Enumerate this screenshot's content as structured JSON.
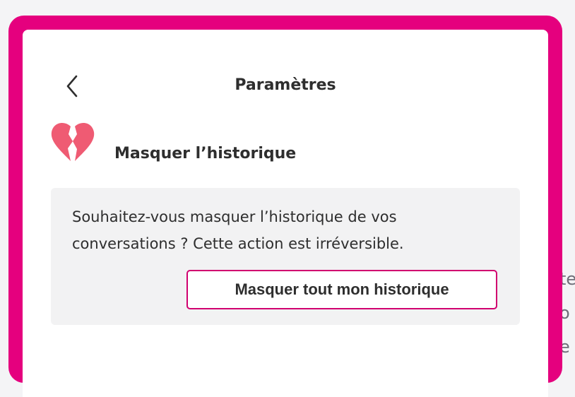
{
  "header": {
    "title": "Paramètres",
    "back_icon": "chevron-left-icon"
  },
  "section": {
    "icon": "broken-heart-icon",
    "title": "Masquer l’historique"
  },
  "info_box": {
    "text_line1": "Souhaitez-vous masquer l’historique de vos",
    "text_line2": "conversations ? Cette action est irréversible.",
    "button_label": "Masquer tout mon historique"
  },
  "background": {
    "fragment1": "te",
    "fragment2": "o",
    "fragment3": "e"
  },
  "colors": {
    "frame": "#e5007e",
    "heart": "#ef5b73",
    "button_border": "#d1006f"
  }
}
